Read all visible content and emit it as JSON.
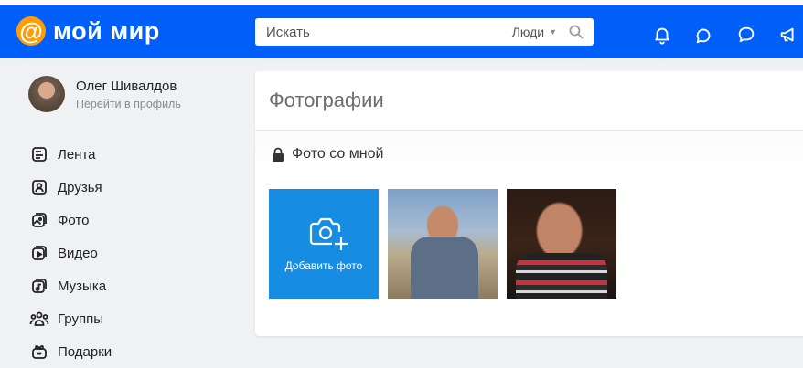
{
  "header": {
    "logo_symbol": "@",
    "logo_text": "мой мир",
    "search": {
      "placeholder": "Искать",
      "scope": "Люди"
    },
    "icons": [
      "bell-icon",
      "chat-bubbles-icon",
      "message-icon",
      "megaphone-icon"
    ]
  },
  "profile": {
    "name": "Олег Шивалдов",
    "link": "Перейти в профиль"
  },
  "nav": {
    "items": [
      {
        "label": "Лента",
        "icon": "feed-icon"
      },
      {
        "label": "Друзья",
        "icon": "friends-icon"
      },
      {
        "label": "Фото",
        "icon": "photos-icon"
      },
      {
        "label": "Видео",
        "icon": "video-icon"
      },
      {
        "label": "Музыка",
        "icon": "music-icon"
      },
      {
        "label": "Группы",
        "icon": "groups-icon"
      },
      {
        "label": "Подарки",
        "icon": "gifts-icon"
      }
    ]
  },
  "page": {
    "title": "Фотографии",
    "section_title": "Фото со мной",
    "add_photo_label": "Добавить фото"
  },
  "colors": {
    "header_bg": "#005ff9",
    "logo_accent": "#ff9e00",
    "add_tile": "#168de2"
  }
}
